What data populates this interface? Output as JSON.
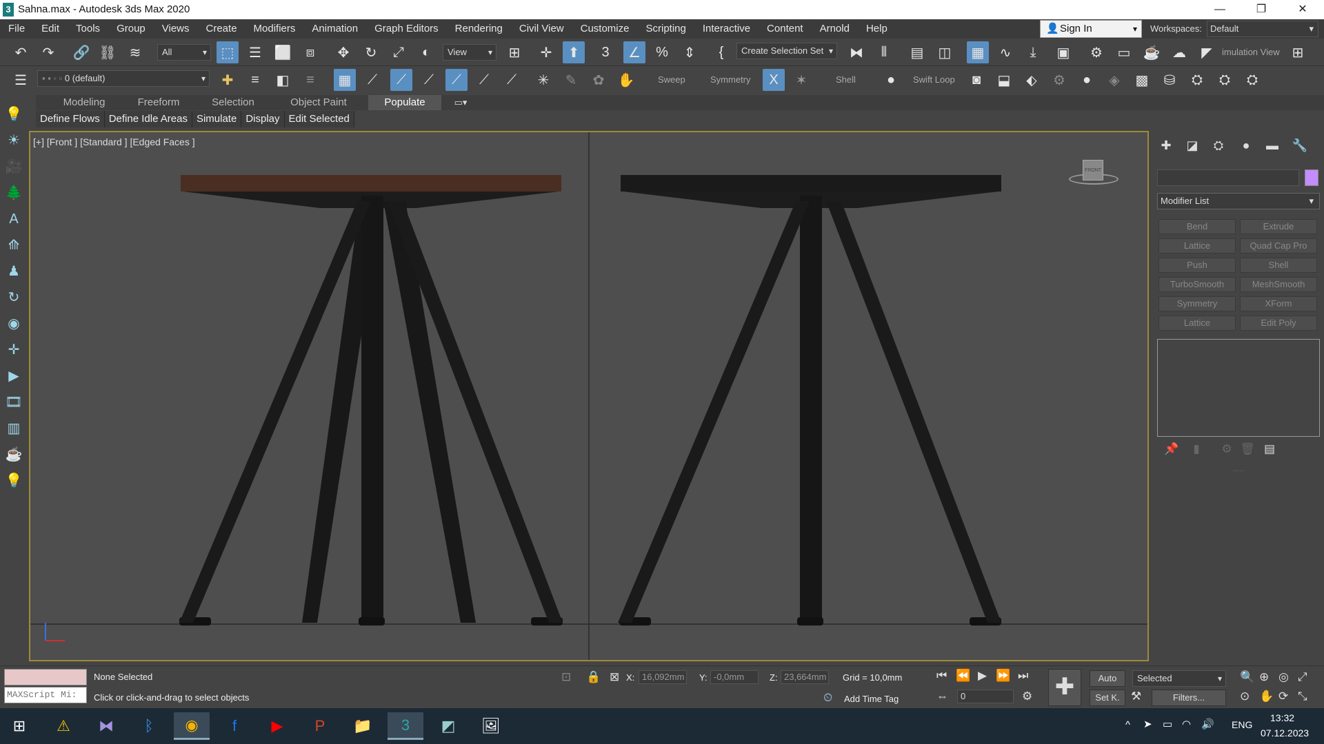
{
  "window": {
    "title": "Sahna.max - Autodesk 3ds Max 2020",
    "app_icon": "3"
  },
  "menu": [
    "File",
    "Edit",
    "Tools",
    "Group",
    "Views",
    "Create",
    "Modifiers",
    "Animation",
    "Graph Editors",
    "Rendering",
    "Civil View",
    "Customize",
    "Scripting",
    "Interactive",
    "Content",
    "Arnold",
    "Help"
  ],
  "signin": {
    "label": "Sign In"
  },
  "workspaces": {
    "label": "Workspaces:",
    "value": "Default"
  },
  "toolbar1": {
    "filter": "All",
    "refcoord": "View",
    "selection_set": "Create Selection Set",
    "sim_label": "imulation View"
  },
  "toolbar2": {
    "layer": "0 (default)",
    "sweep": "Sweep",
    "symmetry": "Symmetry",
    "shell": "Shell",
    "swift_loop": "Swift Loop"
  },
  "ribbon": {
    "tabs": [
      "Modeling",
      "Freeform",
      "Selection",
      "Object Paint",
      "Populate"
    ],
    "active": "Populate"
  },
  "subribbon": [
    "Define Flows",
    "Define Idle Areas",
    "Simulate",
    "Display",
    "Edit Selected"
  ],
  "viewport": {
    "label": "[+] [Front ] [Standard ] [Edged Faces ]",
    "cube_label": "FRONT"
  },
  "command_panel": {
    "modifier_list": "Modifier List",
    "object_color": "#c38cff",
    "modifiers": [
      "Bend",
      "Extrude",
      "Lattice",
      "Quad Cap Pro",
      "Push",
      "Shell",
      "TurboSmooth",
      "MeshSmooth",
      "Symmetry",
      "XForm",
      "Lattice",
      "Edit Poly"
    ]
  },
  "status": {
    "maxscript": "MAXScript Mi:",
    "selection": "None Selected",
    "prompt": "Click or click-and-drag to select objects",
    "x": "16,092mm",
    "y": "-0,0mm",
    "z": "23,664mm",
    "grid": "Grid = 10,0mm",
    "add_time_tag": "Add Time Tag",
    "frame": "0",
    "auto": "Auto",
    "set_key": "Set K.",
    "key_filter": "Selected",
    "filters": "Filters..."
  },
  "taskbar": {
    "lang": "ENG",
    "time": "13:32",
    "date": "07.12.2023"
  }
}
